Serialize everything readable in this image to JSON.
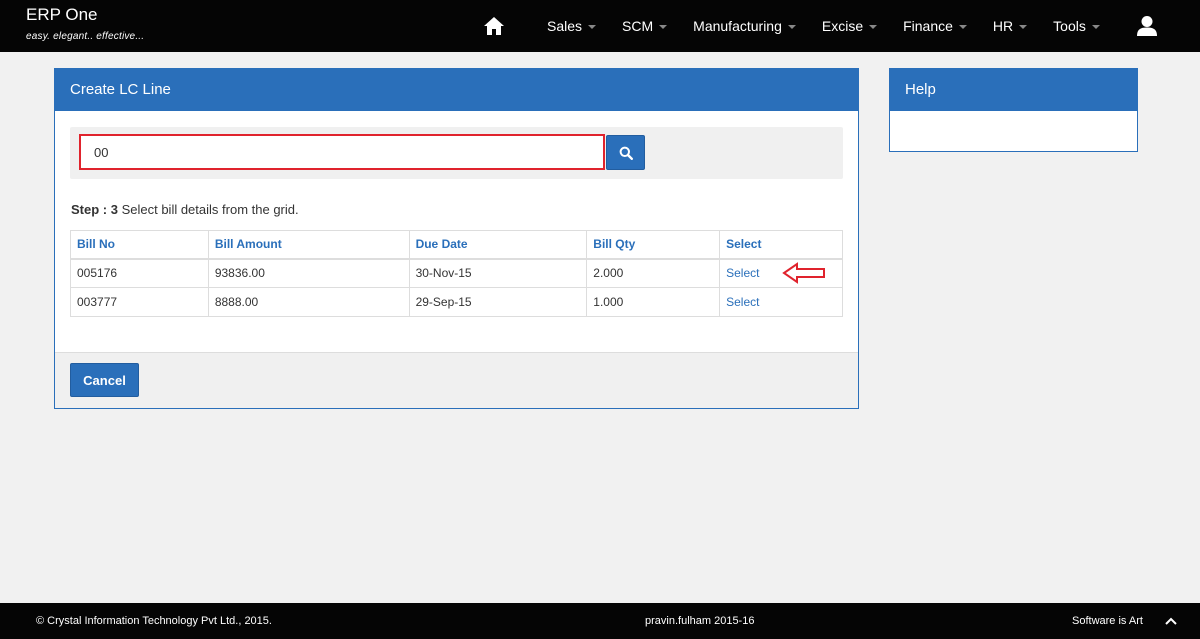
{
  "app": {
    "title": "ERP One",
    "tagline": "easy. elegant.. effective..."
  },
  "nav": {
    "home_icon": "home-icon",
    "items": [
      {
        "label": "Sales"
      },
      {
        "label": "SCM"
      },
      {
        "label": "Manufacturing"
      },
      {
        "label": "Excise"
      },
      {
        "label": "Finance"
      },
      {
        "label": "HR"
      },
      {
        "label": "Tools"
      }
    ],
    "user_icon": "user-icon"
  },
  "main_panel": {
    "title": "Create LC Line",
    "search": {
      "value": "00",
      "placeholder": "",
      "button_icon": "search-icon"
    },
    "step": {
      "label": "Step : 3",
      "text": " Select bill details from the grid."
    },
    "table": {
      "columns": [
        "Bill No",
        "Bill Amount",
        "Due Date",
        "Bill Qty",
        "Select"
      ],
      "rows": [
        {
          "bill_no": "005176",
          "bill_amount": "93836.00",
          "due_date": "30-Nov-15",
          "bill_qty": "2.000",
          "select": "Select"
        },
        {
          "bill_no": "003777",
          "bill_amount": "8888.00",
          "due_date": "29-Sep-15",
          "bill_qty": "1.000",
          "select": "Select"
        }
      ]
    },
    "cancel_label": "Cancel"
  },
  "help_panel": {
    "title": "Help"
  },
  "footer": {
    "copyright": "© Crystal Information Technology Pvt Ltd., 2015.",
    "user": "pravin.fulham 2015-16",
    "slogan": "Software is Art"
  },
  "colors": {
    "accent": "#2a6fba",
    "highlight": "#e0232d",
    "navbar": "#050505"
  }
}
